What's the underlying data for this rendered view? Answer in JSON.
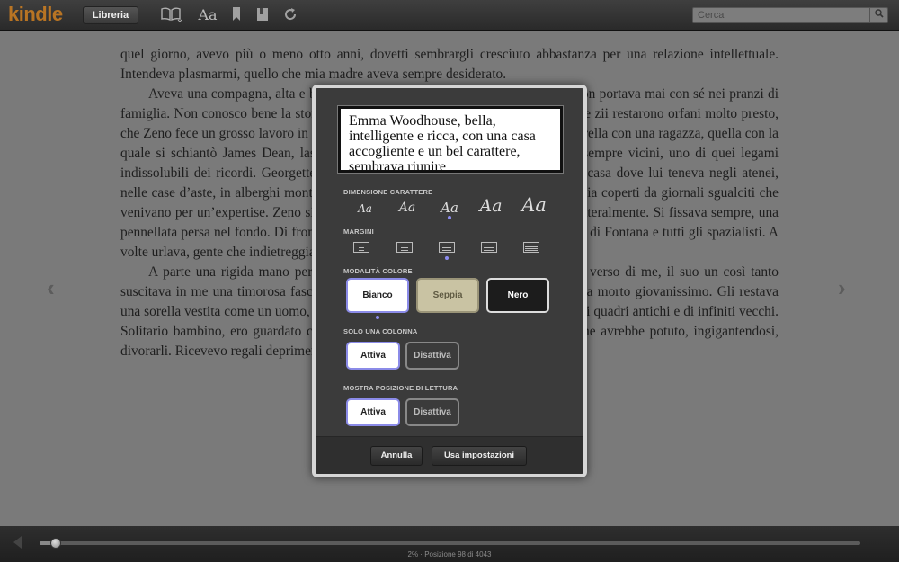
{
  "toolbar": {
    "logo": "kindle",
    "library_label": "Libreria",
    "search_placeholder": "Cerca",
    "icons": [
      "book-icon",
      "font-icon",
      "bookmark-icon",
      "notes-icon",
      "sync-icon",
      "search-icon"
    ],
    "font_icon_glyph": "Aa",
    "accent_color": "#e58a1e"
  },
  "page": {
    "paragraphs": [
      {
        "text": "quel giorno, avevo più o meno otto anni, dovetti sembrargli cresciuto abbastanza per una relazione intellettuale. Intendeva plasmarmi, quello che mia madre aveva sempre desiderato.",
        "indent": false
      },
      {
        "text": "Aveva una compagna, alta e bella, che sembrava una giraffa ferita e che zio non portava mai con sé nei pranzi di famiglia. Non conosco bene la storia di questi due fratelli. La mia nonna, i miei due zii restarono orfani molto presto, che Zeno fece un grosso lavoro in una canonica della Vallonia e si presentò dalla sorella con una ragazza, quella con la quale si schiantò James Dean, lasciarono il Belgio. Non si sposò, ma rimasero sempre vicini, uno di quei legami indissolubili dei ricordi. Georgette gli sbrigava la corrispondenza, organizzava la casa dove lui teneva negli atenei, nelle case d’aste, in alberghi montani, la disgrazia con pezzi di collezioni di famiglia coperti da giornali sgualciti che venivano per un’expertise. Zeno si toglieva gli occhiali, avvicinava, le annusava letteralmente. Si fissava sempre, una pennellata persa nel fondo. Di fronte alla bellezza si commuoveva. Detestava i tagli di Fontana e tutti gli spazialisti. A volte urlava, gente che indietreggiava inciampando nelle scale.",
        "indent": true
      },
      {
        "text": "A parte una rigida mano per la sua mano, non ricordo alcun gesto d’affetto verso di me, il suo un così tanto suscitava in me una timorosa fascinazione e una malinconia per un fratello, ma era morto giovanissimo. Gli restava una sorella vestita come un uomo, sposata ma senza figli. La nostra casa era piena di quadri antichi e di infiniti vecchi. Solitario bambino, ero guardato con timore come una sorta di insetto kafkiano che avrebbe potuto, ingigantendosi, divorarli. Ricevevo regali deprimenti, domini, ombrelli.",
        "indent": true
      }
    ],
    "prev_arrow": "‹",
    "next_arrow": "›"
  },
  "dialog": {
    "preview_text": "Emma Woodhouse, bella, intelligente e ricca, con una casa accogliente e un bel carattere, sembrava riunire",
    "font_size_label": "DIMENSIONE CARATTERE",
    "font_sizes": [
      "Aa",
      "Aa",
      "Aa",
      "Aa",
      "Aa"
    ],
    "font_size_selected": 2,
    "margins_label": "MARGINI",
    "margins_selected": 2,
    "color_mode_label": "MODALITÀ COLORE",
    "color_modes": [
      "Bianco",
      "Seppia",
      "Nero"
    ],
    "color_mode_selected": "Bianco",
    "single_column_label": "SOLO UNA COLONNA",
    "single_column_on": "Attiva",
    "single_column_off": "Disattiva",
    "reading_position_label": "MOSTRA POSIZIONE DI LETTURA",
    "reading_position_on": "Attiva",
    "reading_position_off": "Disattiva",
    "cancel_label": "Annulla",
    "apply_label": "Usa impostazioni",
    "selection_color": "#8b8be8"
  },
  "progress": {
    "label": "2% · Posizione 98 di 4043",
    "percent": 2
  }
}
